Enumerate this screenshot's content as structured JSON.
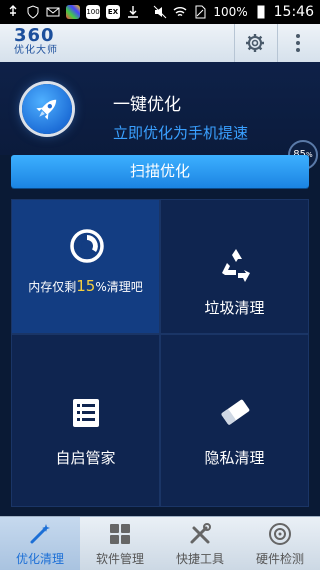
{
  "status_bar": {
    "battery": "100%",
    "time": "15:46",
    "app_icons": [
      "100",
      "EX"
    ]
  },
  "app_bar": {
    "logo_number": "360",
    "logo_text": "优化大师",
    "settings_icon": "gear-icon",
    "more_icon": "more-vertical-icon"
  },
  "hero": {
    "title": "一键优化",
    "subtitle": "立即优化为手机提速",
    "badge_value": "85",
    "badge_unit": "%"
  },
  "scan_button": "扫描优化",
  "tiles": {
    "memory": {
      "prefix": "内存仅剩",
      "percent": "15",
      "suffix": "%清理吧"
    },
    "junk": "垃圾清理",
    "autostart": "自启管家",
    "privacy": "隐私清理"
  },
  "tabs": [
    {
      "label": "优化清理",
      "icon": "magic-wand-icon"
    },
    {
      "label": "软件管理",
      "icon": "apps-grid-icon"
    },
    {
      "label": "快捷工具",
      "icon": "tools-icon"
    },
    {
      "label": "硬件检测",
      "icon": "hardware-icon"
    }
  ],
  "colors": {
    "accent": "#1b84e2",
    "highlight_tile": "#133d82",
    "percent_text": "#f5d040"
  }
}
